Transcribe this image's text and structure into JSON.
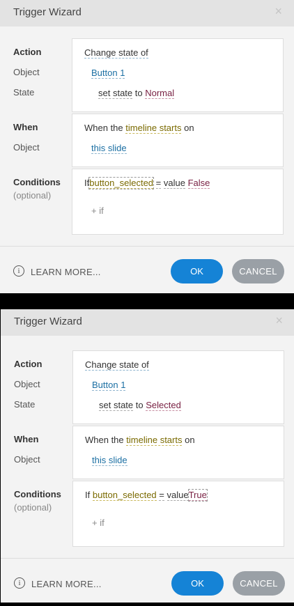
{
  "dialogs": [
    {
      "title": "Trigger Wizard",
      "close_icon": "×",
      "action_label": "Action",
      "object_label": "Object",
      "state_label": "State",
      "action_text": "Change state of",
      "object_value": "Button 1",
      "set_state_text": "set state",
      "to_text": "to",
      "state_value": "Normal",
      "when_label": "When",
      "when_object_label": "Object",
      "when_prefix": "When the",
      "when_event": "timeline starts",
      "when_suffix": "on",
      "when_object": "this slide",
      "conditions_label": "Conditions",
      "conditions_sub": "(optional)",
      "if_text": "If",
      "variable": "button_selected",
      "operator": "=",
      "value_text": "value",
      "value": "False",
      "add_if": "+ if",
      "info_icon": "i",
      "learn_more": "LEARN MORE...",
      "ok": "OK",
      "cancel": "CANCEL"
    },
    {
      "title": "Trigger Wizard",
      "close_icon": "×",
      "action_label": "Action",
      "object_label": "Object",
      "state_label": "State",
      "action_text": "Change state of",
      "object_value": "Button 1",
      "set_state_text": "set state",
      "to_text": "to",
      "state_value": "Selected",
      "when_label": "When",
      "when_object_label": "Object",
      "when_prefix": "When the",
      "when_event": "timeline starts",
      "when_suffix": "on",
      "when_object": "this slide",
      "conditions_label": "Conditions",
      "conditions_sub": "(optional)",
      "if_text": "If",
      "variable": "button_selected",
      "operator": "=",
      "value_text": "value",
      "value": "True",
      "add_if": "+ if",
      "info_icon": "i",
      "learn_more": "LEARN MORE...",
      "ok": "OK",
      "cancel": "CANCEL"
    }
  ]
}
